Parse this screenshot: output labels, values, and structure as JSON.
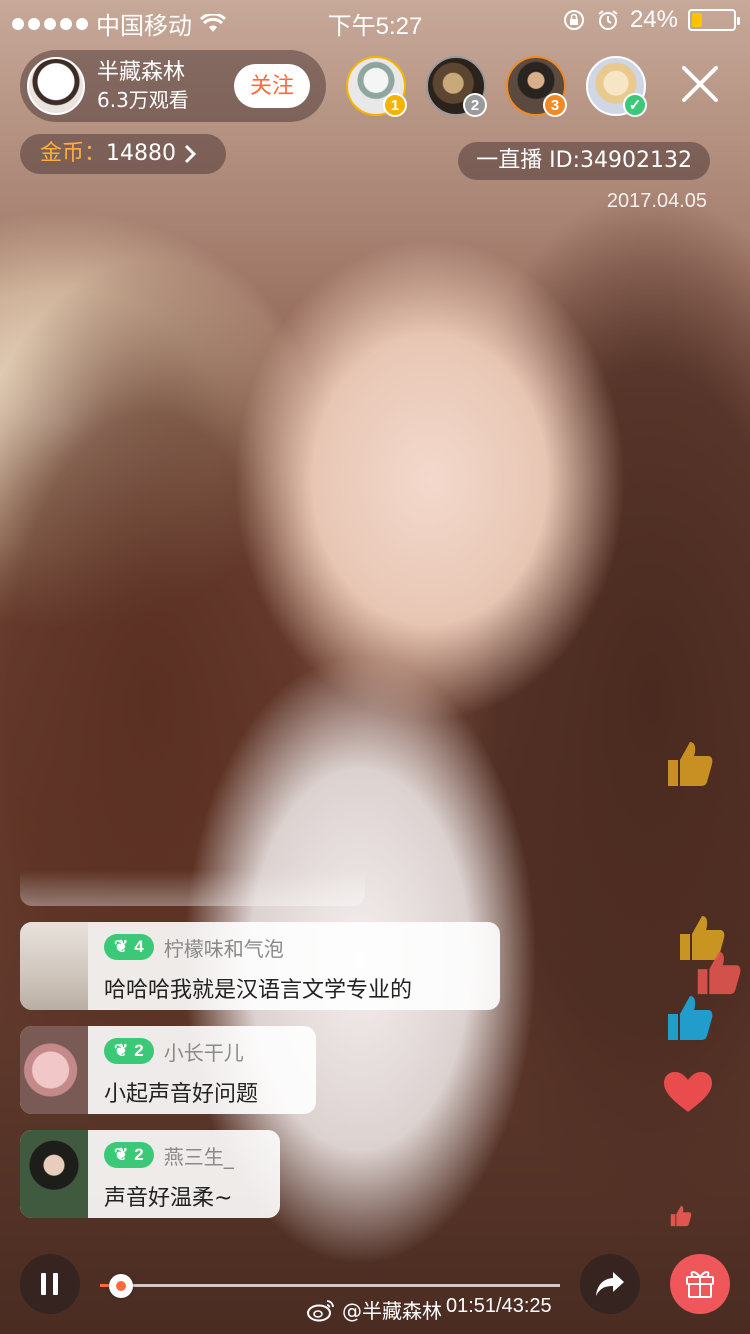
{
  "status": {
    "carrier": "中国移动",
    "time": "下午5:27",
    "battery_text": "24%",
    "battery_level": 0.24
  },
  "host": {
    "name": "半藏森林",
    "views": "6.3万观看",
    "follow_label": "关注"
  },
  "viewers": [
    {
      "rank": "1",
      "badge_color": "#f5b400"
    },
    {
      "rank": "2",
      "badge_color": "#9a9a9a"
    },
    {
      "rank": "3",
      "badge_color": "#f08a24"
    },
    {
      "rank": "",
      "badge_color": "#3cc977"
    }
  ],
  "coins": {
    "label": "金币：",
    "value": "14880"
  },
  "live": {
    "id_text": "一直播 ID:34902132",
    "date": "2017.04.05"
  },
  "comments": [
    {
      "level": "4",
      "user": "柠檬味和气泡",
      "text": "哈哈哈我就是汉语言文学专业的"
    },
    {
      "level": "2",
      "user": "小长干儿",
      "text": "小起声音好问题"
    },
    {
      "level": "2",
      "user": "燕三生_",
      "text": "声音好温柔~"
    }
  ],
  "player": {
    "progress": 0.045,
    "elapsed_total": "01:51/43:25",
    "watermark": "@半藏森林"
  },
  "colors": {
    "accent": "#ff6a3d",
    "level_green": "#3cc977",
    "gift": "#f0575a"
  }
}
